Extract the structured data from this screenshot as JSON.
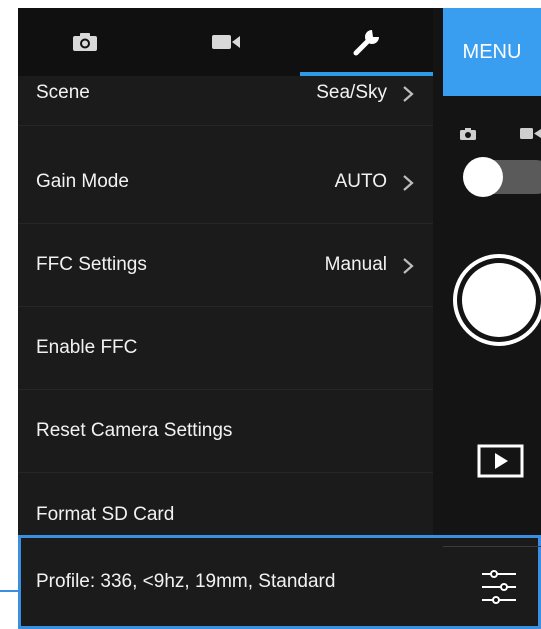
{
  "tabs": [
    {
      "icon": "camera-icon"
    },
    {
      "icon": "video-icon"
    },
    {
      "icon": "wrench-icon",
      "active": true
    }
  ],
  "settings": [
    {
      "label": "Scene",
      "value": "Sea/Sky",
      "chevron": true
    },
    {
      "label": "Gain Mode",
      "value": "AUTO",
      "chevron": true
    },
    {
      "label": "FFC Settings",
      "value": "Manual",
      "chevron": true
    },
    {
      "label": "Enable FFC",
      "value": "",
      "chevron": false
    },
    {
      "label": "Reset Camera Settings",
      "value": "",
      "chevron": false
    },
    {
      "label": "Format SD Card",
      "value": "",
      "chevron": false
    }
  ],
  "profile": {
    "label": "Profile:  336, <9hz, 19mm, Standard"
  },
  "side": {
    "menu_label": "MENU",
    "mode_icons": [
      "camera-icon",
      "video-icon"
    ],
    "toggle_state": "photo"
  },
  "colors": {
    "accent": "#3a9ef0",
    "background": "#141414",
    "list_bg": "#1b1b1b"
  }
}
